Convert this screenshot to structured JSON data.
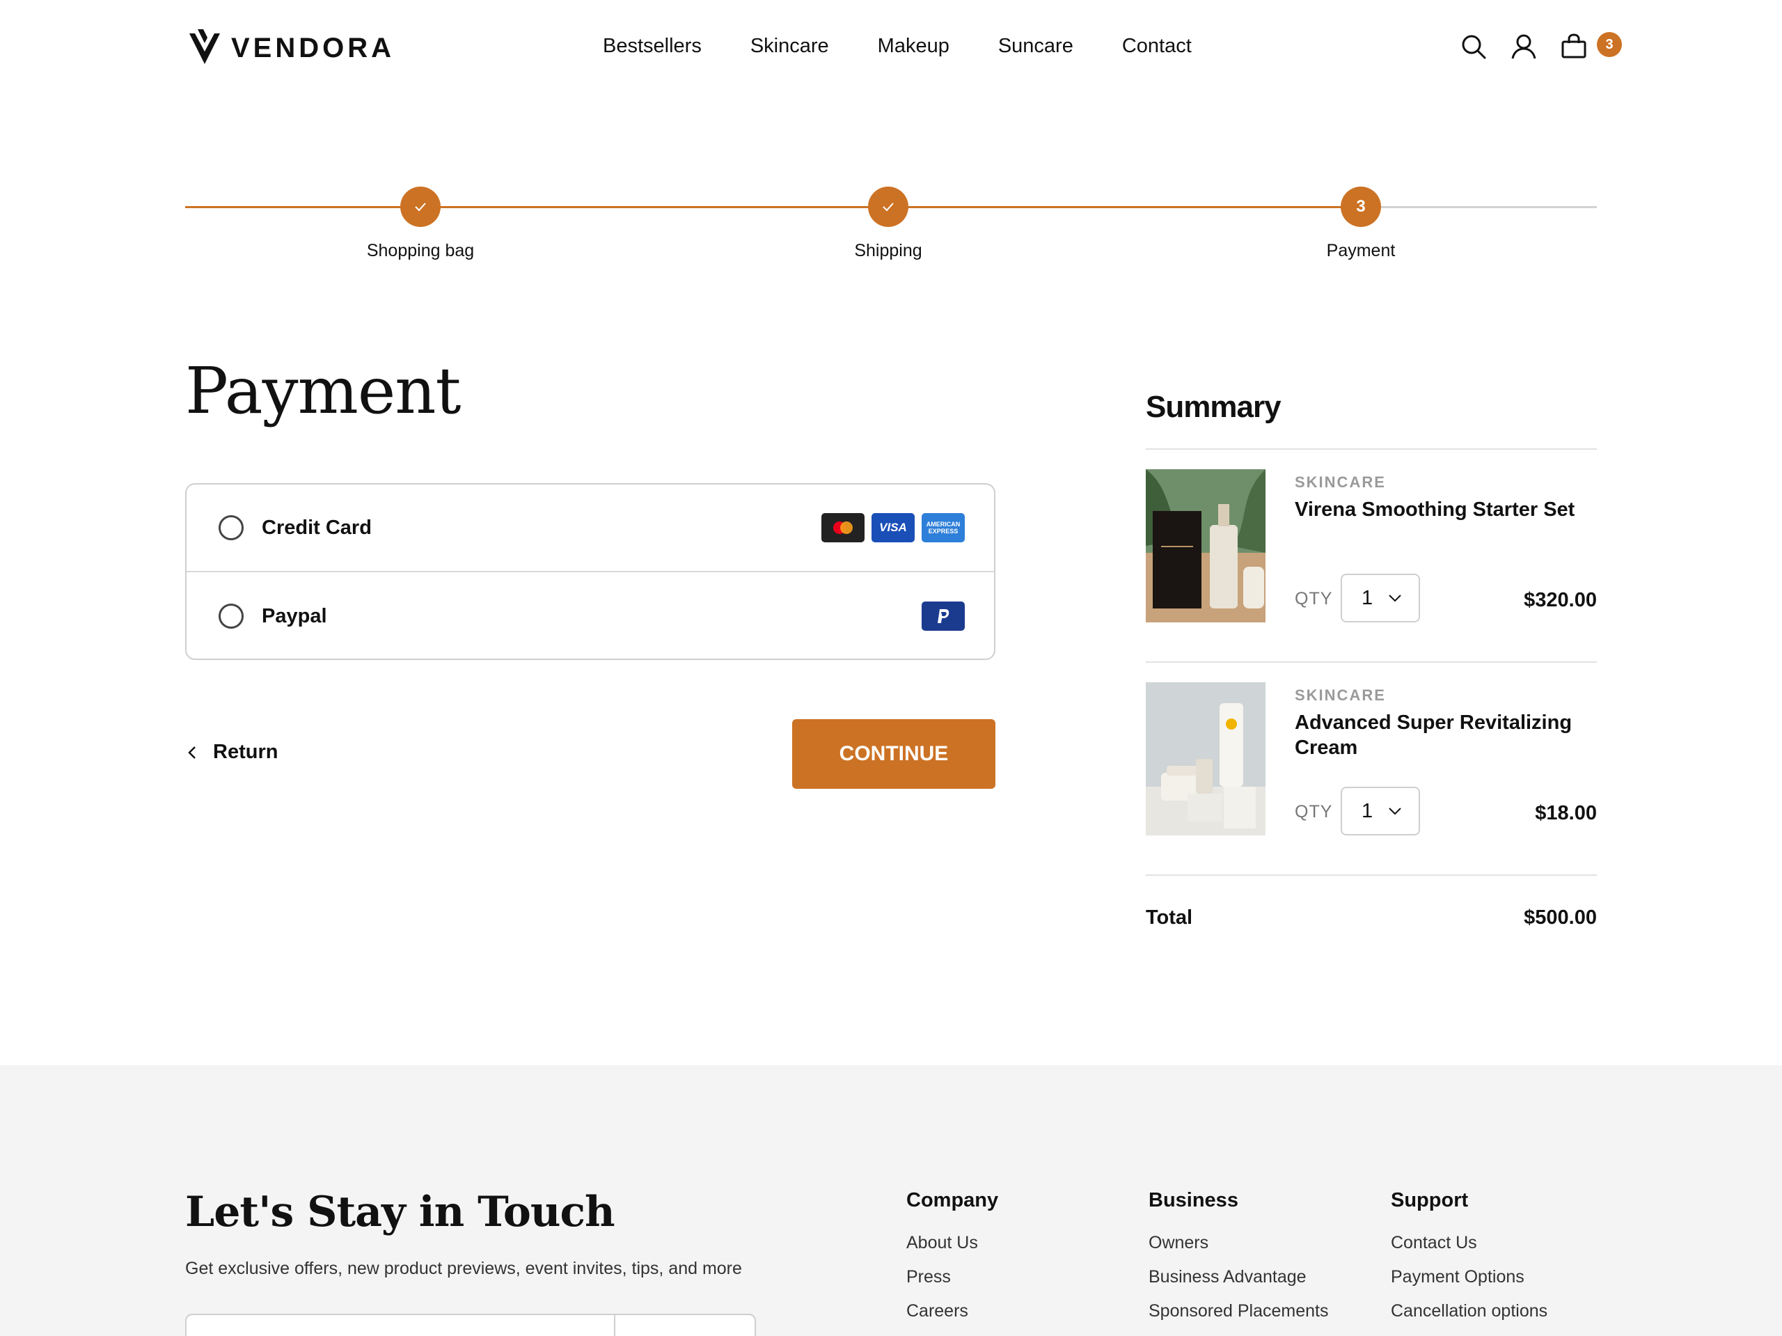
{
  "brand": {
    "name": "VENDORA",
    "accent": "#cc7224"
  },
  "nav": {
    "items": [
      "Bestsellers",
      "Skincare",
      "Makeup",
      "Suncare",
      "Contact"
    ]
  },
  "header": {
    "cart_count": "3",
    "icons": [
      "search-icon",
      "user-icon",
      "shopping-bag-icon"
    ]
  },
  "stepper": {
    "steps": [
      {
        "label": "Shopping bag",
        "state": "done"
      },
      {
        "label": "Shipping",
        "state": "done"
      },
      {
        "label": "Payment",
        "state": "current",
        "number": "3"
      }
    ]
  },
  "payment": {
    "title": "Payment",
    "methods": [
      {
        "label": "Credit Card",
        "logos": [
          "mastercard",
          "VISA",
          "AMERICAN EXPRESS"
        ]
      },
      {
        "label": "Paypal",
        "logos": [
          "paypal"
        ]
      }
    ],
    "return_label": "Return",
    "continue_label": "CONTINUE"
  },
  "summary": {
    "title": "Summary",
    "qty_label": "QTY",
    "items": [
      {
        "category": "SKINCARE",
        "name": "Virena Smoothing Starter Set",
        "qty": "1",
        "price": "$320.00"
      },
      {
        "category": "SKINCARE",
        "name": "Advanced Super Revitalizing Cream",
        "qty": "1",
        "price": "$18.00"
      }
    ],
    "total_label": "Total",
    "total_value": "$500.00"
  },
  "footer": {
    "title": "Let's Stay in Touch",
    "subtitle": "Get exclusive offers, new product previews, event invites, tips, and more",
    "columns": [
      {
        "heading": "Company",
        "links": [
          "About Us",
          "Press",
          "Careers"
        ]
      },
      {
        "heading": "Business",
        "links": [
          "Owners",
          "Business Advantage",
          "Sponsored Placements"
        ]
      },
      {
        "heading": "Support",
        "links": [
          "Contact Us",
          "Payment Options",
          "Cancellation options"
        ]
      }
    ]
  }
}
